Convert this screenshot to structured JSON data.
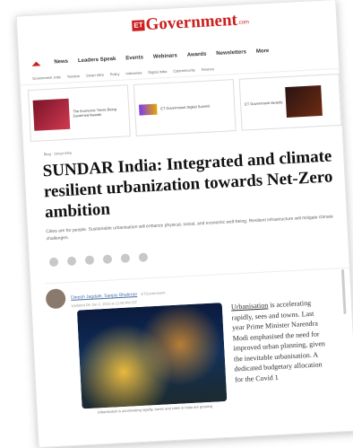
{
  "site": {
    "logo_badge": "ET",
    "name": "Government",
    "suffix": ".com"
  },
  "nav": {
    "items": [
      "News",
      "Leaders Speak",
      "Events",
      "Webinars",
      "Awards",
      "Newsletters",
      "More"
    ]
  },
  "subnav": {
    "items": [
      "Government Jobs",
      "Tenders",
      "Smart Infra",
      "Policy",
      "Interviews",
      "Digital India",
      "Cybersecurity",
      "Finance"
    ]
  },
  "promos": [
    {
      "text": "The Economic Times Being Governed Awards"
    },
    {
      "text": "ET Government Digital Summit"
    },
    {
      "text": "ET Government Awards"
    }
  ],
  "breadcrumb": "Blog · Smart Infra",
  "article": {
    "headline": "SUNDAR India: Integrated and climate resilient urbanization towards Net-Zero ambition",
    "summary": "Cities are for people. Sustainable urbanisation will enhance physical, social, and economic well-being. Resilient infrastructure will mitigate climate challenges.",
    "author": "Dinesh Jagdale, Sanjay Bhalerao",
    "updated_label": "ETGovernment",
    "date": "Updated On Jan 2, 2023 at 12:00 PM IST",
    "caption": "Urbanisation is accelerating rapidly, towns and cities in India are growing",
    "body_link": "Urbanisation",
    "body": " is accelerating rapidly, sees and towns. Last year Prime Minister Narendra Modi emphasised the need for improved urban planning, given the inevitable urbanisation. A dedicated budgetary allocation for the Covid 1"
  },
  "share": [
    "facebook-icon",
    "whatsapp-icon",
    "linkedin-icon",
    "twitter-icon",
    "email-icon",
    "link-icon"
  ]
}
